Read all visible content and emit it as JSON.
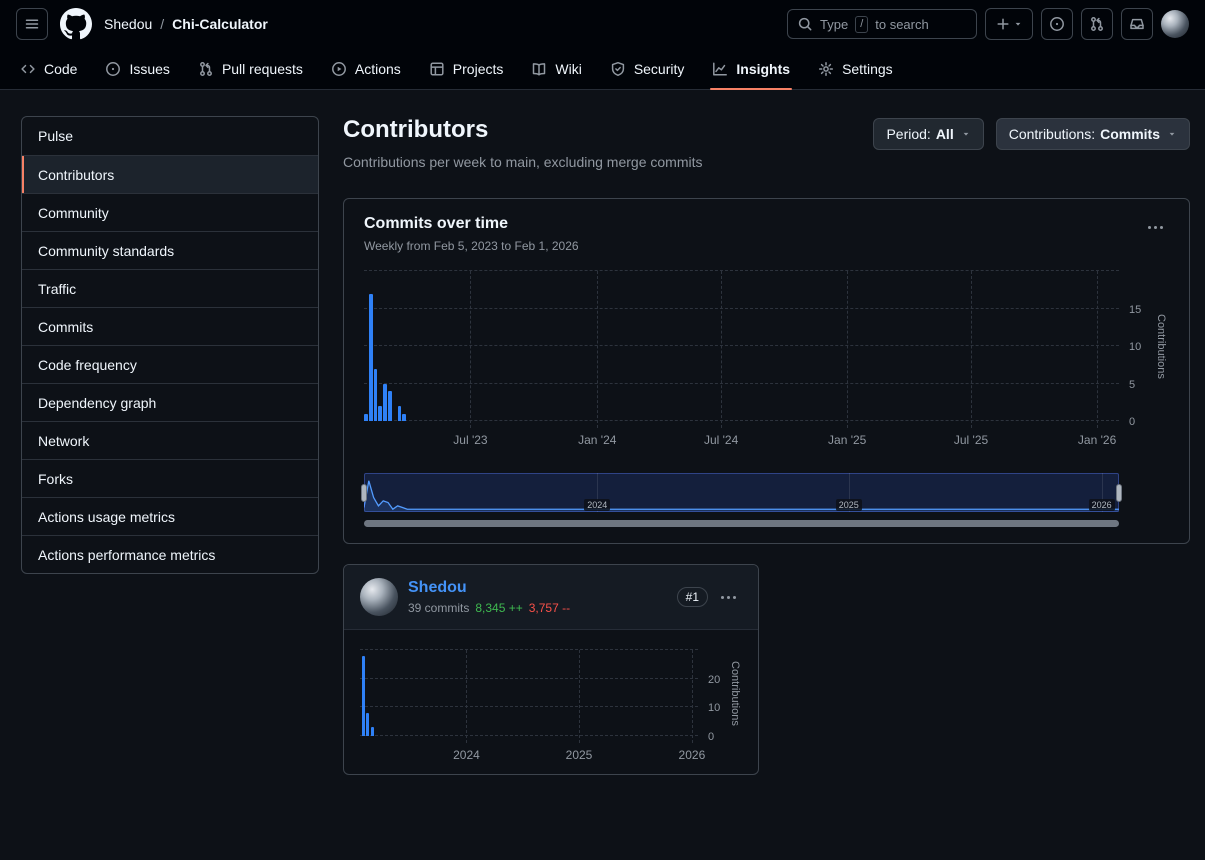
{
  "colors": {
    "accent_blue": "#4493f8",
    "bar_blue": "#2f81f7",
    "tab_active_underline": "#f78166",
    "additions_green": "#3fb950",
    "deletions_red": "#f85149"
  },
  "header": {
    "owner": "Shedou",
    "breadcrumb_separator": "/",
    "repo": "Chi-Calculator",
    "search": {
      "prefix": "Type",
      "slash_key": "/",
      "suffix": "to search"
    },
    "icons": {
      "menu": "hamburger-icon",
      "logo": "github-mark-icon",
      "search": "search-icon",
      "create": "plus-icon",
      "issues": "issue-opened-icon",
      "pull_requests": "git-pull-request-icon",
      "inbox": "inbox-icon"
    }
  },
  "nav": {
    "tabs": [
      {
        "label": "Code",
        "icon": "code-icon",
        "active": false
      },
      {
        "label": "Issues",
        "icon": "issue-opened-icon",
        "active": false
      },
      {
        "label": "Pull requests",
        "icon": "git-pull-request-icon",
        "active": false
      },
      {
        "label": "Actions",
        "icon": "play-icon",
        "active": false
      },
      {
        "label": "Projects",
        "icon": "table-icon",
        "active": false
      },
      {
        "label": "Wiki",
        "icon": "book-icon",
        "active": false
      },
      {
        "label": "Security",
        "icon": "shield-icon",
        "active": false
      },
      {
        "label": "Insights",
        "icon": "graph-icon",
        "active": true
      },
      {
        "label": "Settings",
        "icon": "gear-icon",
        "active": false
      }
    ]
  },
  "sidebar": {
    "items": [
      {
        "label": "Pulse",
        "active": false
      },
      {
        "label": "Contributors",
        "active": true
      },
      {
        "label": "Community",
        "active": false
      },
      {
        "label": "Community standards",
        "active": false
      },
      {
        "label": "Traffic",
        "active": false
      },
      {
        "label": "Commits",
        "active": false
      },
      {
        "label": "Code frequency",
        "active": false
      },
      {
        "label": "Dependency graph",
        "active": false
      },
      {
        "label": "Network",
        "active": false
      },
      {
        "label": "Forks",
        "active": false
      },
      {
        "label": "Actions usage metrics",
        "active": false
      },
      {
        "label": "Actions performance metrics",
        "active": false
      }
    ]
  },
  "main": {
    "title": "Contributors",
    "subtitle": "Contributions per week to main, excluding merge commits",
    "period_filter": {
      "label": "Period:",
      "value": "All"
    },
    "contributions_filter": {
      "label": "Contributions:",
      "value": "Commits"
    }
  },
  "chart_data": [
    {
      "id": "commits-over-time",
      "type": "bar",
      "title": "Commits over time",
      "subtitle": "Weekly from Feb 5, 2023 to Feb 1, 2026",
      "ylabel": "Contributions",
      "total_weeks": 157,
      "y_max": 20,
      "x_ticks": [
        {
          "label": "Jul '23",
          "frac": 0.141
        },
        {
          "label": "Jan '24",
          "frac": 0.309
        },
        {
          "label": "Jul '24",
          "frac": 0.473
        },
        {
          "label": "Jan '25",
          "frac": 0.64
        },
        {
          "label": "Jul '25",
          "frac": 0.804
        },
        {
          "label": "Jan '26",
          "frac": 0.971
        }
      ],
      "y_ticks": [
        {
          "label": "0",
          "value": 0
        },
        {
          "label": "5",
          "value": 5
        },
        {
          "label": "10",
          "value": 10
        },
        {
          "label": "15",
          "value": 15
        }
      ],
      "bars": [
        {
          "week": 0,
          "value": 1
        },
        {
          "week": 1,
          "value": 17
        },
        {
          "week": 2,
          "value": 7
        },
        {
          "week": 3,
          "value": 2
        },
        {
          "week": 4,
          "value": 5
        },
        {
          "week": 5,
          "value": 4
        },
        {
          "week": 7,
          "value": 2
        },
        {
          "week": 8,
          "value": 1
        }
      ]
    },
    {
      "id": "brush-minimap",
      "type": "area",
      "total_weeks": 157,
      "y_max": 20,
      "x_ticks": [
        {
          "label": "2024",
          "frac": 0.309
        },
        {
          "label": "2025",
          "frac": 0.642
        },
        {
          "label": "2026",
          "frac": 0.977
        }
      ]
    },
    {
      "id": "contributor-shedou",
      "type": "bar",
      "ylabel": "Contributions",
      "total_weeks": 157,
      "y_max": 30,
      "x_ticks": [
        {
          "label": "2024",
          "frac": 0.315
        },
        {
          "label": "2025",
          "frac": 0.648
        },
        {
          "label": "2026",
          "frac": 0.982
        }
      ],
      "y_ticks": [
        {
          "label": "0",
          "value": 0
        },
        {
          "label": "10",
          "value": 10
        },
        {
          "label": "20",
          "value": 20
        }
      ],
      "bars": [
        {
          "week": 1,
          "value": 28
        },
        {
          "week": 3,
          "value": 8
        },
        {
          "week": 5,
          "value": 3
        }
      ]
    }
  ],
  "contributor_card": {
    "name": "Shedou",
    "commits": "39 commits",
    "additions": "8,345 ++",
    "deletions": "3,757 --",
    "rank": "#1"
  }
}
